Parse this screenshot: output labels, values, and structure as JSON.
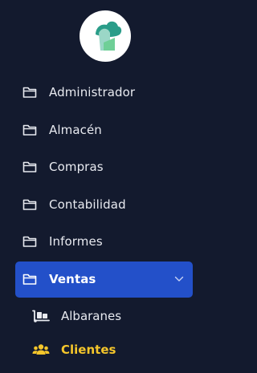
{
  "brand": {
    "logo_icon": "cloud-leaf-logo",
    "colors": {
      "mint": "#9bd7c7",
      "teal": "#2a9d89",
      "green": "#6fcf97"
    }
  },
  "sidebar": {
    "background": "#131a2e",
    "items": [
      {
        "label": "Administrador",
        "icon": "folder-icon"
      },
      {
        "label": "Almacén",
        "icon": "folder-icon"
      },
      {
        "label": "Compras",
        "icon": "folder-icon"
      },
      {
        "label": "Contabilidad",
        "icon": "folder-icon"
      },
      {
        "label": "Informes",
        "icon": "folder-icon"
      },
      {
        "label": "Ventas",
        "icon": "folder-icon",
        "active": true,
        "expanded": true,
        "active_color": "#2350c9"
      }
    ],
    "subitems": [
      {
        "label": "Albaranes",
        "icon": "dolly-icon"
      },
      {
        "label": "Clientes",
        "icon": "users-icon",
        "current": true,
        "current_color": "#f5c62b"
      }
    ]
  }
}
